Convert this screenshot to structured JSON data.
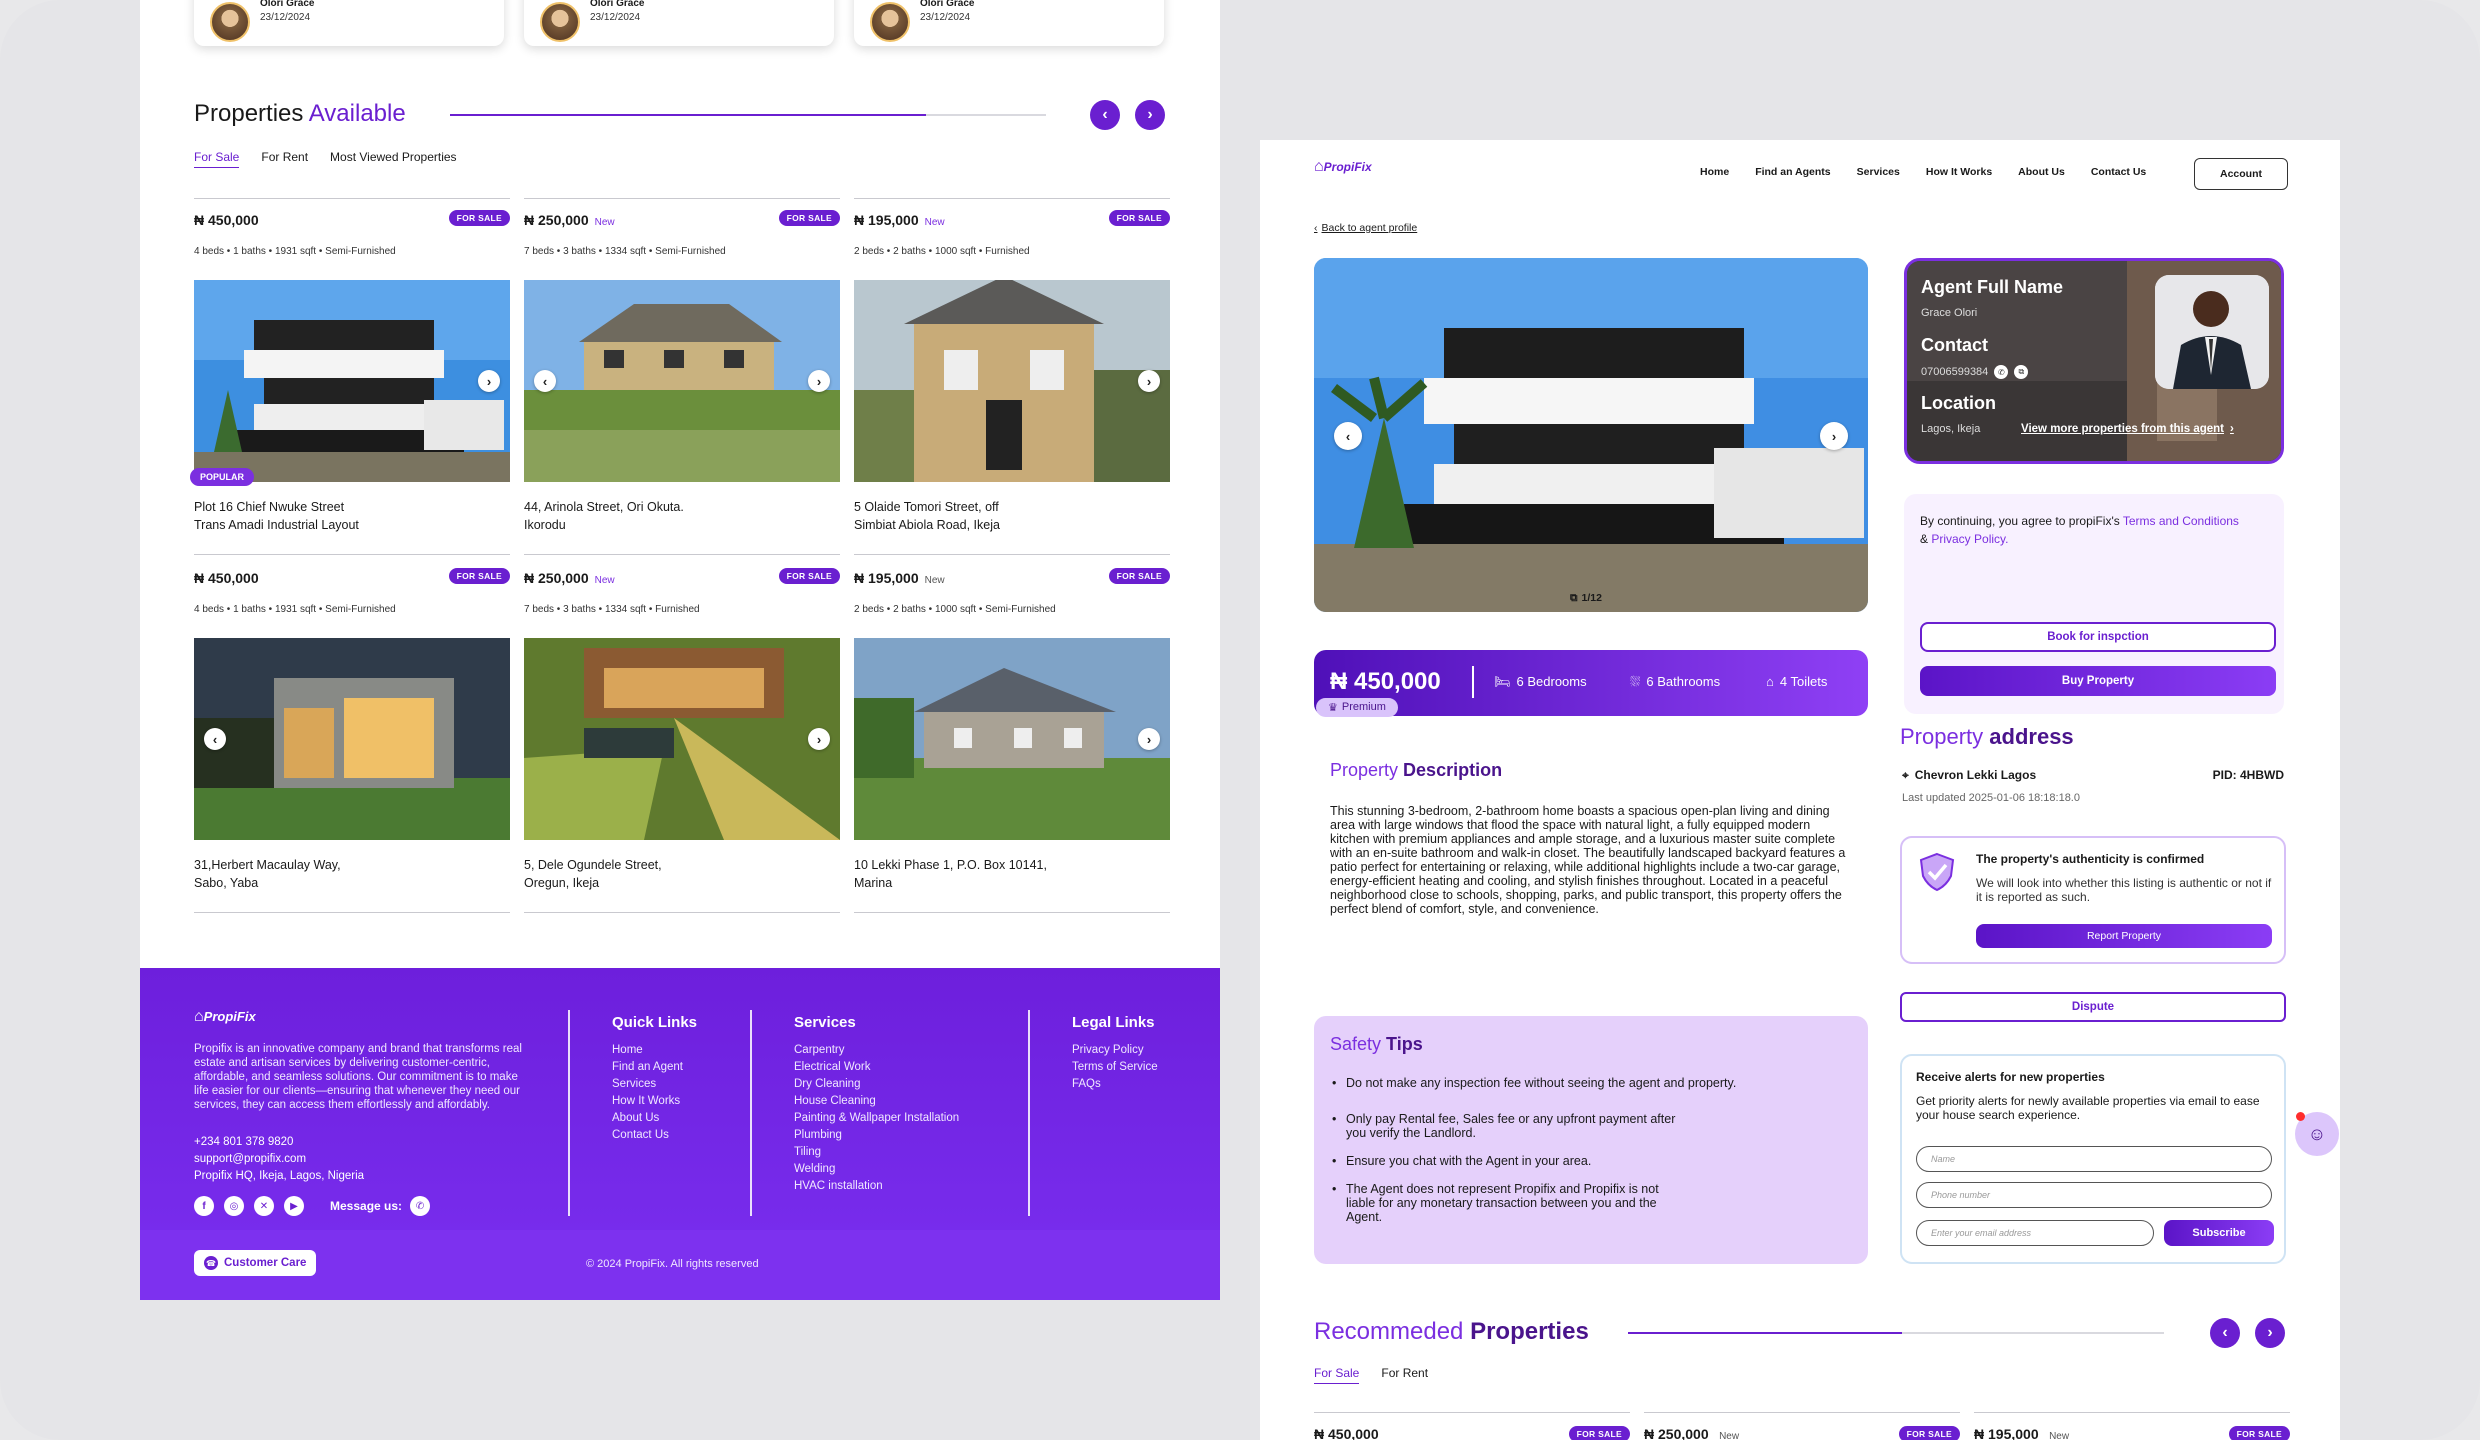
{
  "reviews": [
    {
      "name": "Olori Grace",
      "date": "23/12/2024"
    },
    {
      "name": "Olori Grace",
      "date": "23/12/2024"
    },
    {
      "name": "Olori Grace",
      "date": "23/12/2024"
    }
  ],
  "available": {
    "title_a": "Properties",
    "title_b": "Available",
    "tabs": [
      "For Sale",
      "For Rent",
      "Most Viewed Properties"
    ],
    "prev": "‹",
    "next": "›",
    "cards": [
      {
        "price": "₦ 450,000",
        "new": "",
        "badge": "FOR SALE",
        "spec": "4 beds • 1 baths • 1931 sqft • Semi-Furnished",
        "addr1": "Plot 16 Chief Nwuke Street",
        "addr2": "Trans Amadi Industrial Layout",
        "popular": "POPULAR"
      },
      {
        "price": "₦ 250,000",
        "new": "New",
        "badge": "FOR SALE",
        "spec": "7 beds • 3 baths • 1334 sqft • Semi-Furnished",
        "addr1": "44, Arinola Street, Ori Okuta.",
        "addr2": "Ikorodu"
      },
      {
        "price": "₦ 195,000",
        "new": "New",
        "badge": "FOR SALE",
        "spec": "2 beds • 2 baths • 1000 sqft • Furnished",
        "addr1": "5 Olaide Tomori Street, off",
        "addr2": "Simbiat Abiola Road, Ikeja"
      },
      {
        "price": "₦ 450,000",
        "new": "",
        "badge": "FOR SALE",
        "spec": "4 beds • 1 baths • 1931 sqft • Semi-Furnished",
        "addr1": "31,Herbert Macaulay Way,",
        "addr2": "Sabo, Yaba"
      },
      {
        "price": "₦ 250,000",
        "new": "New",
        "badge": "FOR SALE",
        "spec": "7 beds • 3 baths • 1334 sqft • Furnished",
        "addr1": "5, Dele Ogundele Street,",
        "addr2": "Oregun, Ikeja"
      },
      {
        "price": "₦ 195,000",
        "new": "New",
        "badge": "FOR SALE",
        "spec": "2 beds • 2 baths • 1000 sqft • Semi-Furnished",
        "addr1": "10 Lekki Phase 1, P.O. Box 10141,",
        "addr2": "Marina"
      }
    ]
  },
  "footer": {
    "brand": "PropiFix",
    "about": "Propifix is an innovative company and brand that transforms real estate and artisan services by delivering customer-centric, affordable, and seamless solutions. Our commitment is to make life easier for our clients—ensuring that whenever they need our services, they can access them effortlessly and affordably.",
    "phone": "+234 801 378 9820",
    "email": "support@propifix.com",
    "address": "Propifix HQ, Ikeja, Lagos, Nigeria",
    "message_us": "Message us:",
    "quick_title": "Quick Links",
    "quick": [
      "Home",
      "Find an Agent",
      "Services",
      "How It Works",
      "About Us",
      "Contact Us"
    ],
    "services_title": "Services",
    "services": [
      "Carpentry",
      "Electrical Work",
      "Dry Cleaning",
      "House Cleaning",
      "Painting & Wallpaper Installation",
      "Plumbing",
      "Tiling",
      "Welding",
      "HVAC installation"
    ],
    "legal_title": "Legal Links",
    "legal": [
      "Privacy Policy",
      "Terms of Service",
      "FAQs"
    ],
    "customer_care": "Customer Care",
    "copyright": "© 2024 PropiFix. All rights reserved"
  },
  "detail": {
    "brand": "PropiFix",
    "nav": [
      "Home",
      "Find an Agents",
      "Services",
      "How It Works",
      "About Us",
      "Contact Us"
    ],
    "account": "Account",
    "back": "Back to agent profile",
    "counter": "1/12",
    "price": "₦ 450,000",
    "bedrooms": "6 Bedrooms",
    "bathrooms": "6 Bathrooms",
    "toilets": "4 Toilets",
    "premium": "Premium",
    "agent": {
      "name_label": "Agent Full Name",
      "name": "Grace Olori",
      "contact_label": "Contact",
      "phone": "07006599384",
      "location_label": "Location",
      "location": "Lagos, Ikeja",
      "more": "View more properties from this agent"
    },
    "terms_a": "By continuing, you agree to propiFix's ",
    "terms_link": "Terms and Conditions",
    "terms_amp": " & ",
    "privacy_link": "Privacy Policy.",
    "book": "Book for inspction",
    "buy": "Buy Property",
    "address_title_a": "Property",
    "address_title_b": "address",
    "address": "Chevron Lekki Lagos",
    "pid": "PID: 4HBWD",
    "updated": "Last updated 2025-01-06 18:18:18.0",
    "desc_title_a": "Property",
    "desc_title_b": "Description",
    "description": "This stunning 3-bedroom, 2-bathroom home boasts a spacious open-plan living and dining area with large windows that flood the space with natural light, a fully equipped modern kitchen with premium appliances and ample storage, and a luxurious master suite complete with an en-suite bathroom and walk-in closet. The beautifully landscaped backyard features a patio perfect for entertaining or relaxing, while additional highlights include a two-car garage, energy-efficient heating and cooling, and stylish finishes throughout. Located in a peaceful neighborhood close to schools, shopping, parks, and public transport, this property offers the perfect blend of comfort, style, and convenience.",
    "auth_title": "The property's authenticity is confirmed",
    "auth_text": "We will look into whether this listing is authentic or not if it is reported as such.",
    "report": "Report Property",
    "dispute": "Dispute",
    "safety_a": "Safety",
    "safety_b": "Tips",
    "tips": [
      "Do not make any inspection fee without seeing the agent and property.",
      "Only pay Rental fee, Sales fee or any upfront payment after you verify the Landlord.",
      "Ensure you chat with the Agent in your area.",
      "The Agent does not represent Propifix and Propifix is not liable for any monetary transaction between you and the Agent."
    ],
    "alerts_title": "Receive alerts for new properties",
    "alerts_text": "Get priority alerts for newly available properties via email to ease your house search experience.",
    "ph_name": "Name",
    "ph_phone": "Phone number",
    "ph_email": "Enter your email address",
    "subscribe": "Subscribe",
    "rec_a": "Recommeded",
    "rec_b": "Properties",
    "rec_tabs": [
      "For Sale",
      "For Rent"
    ],
    "rec": [
      {
        "price": "₦ 450,000",
        "new": "",
        "badge": "FOR SALE"
      },
      {
        "price": "₦ 250,000",
        "new": "New",
        "badge": "FOR SALE"
      },
      {
        "price": "₦ 195,000",
        "new": "New",
        "badge": "FOR SALE"
      }
    ]
  }
}
